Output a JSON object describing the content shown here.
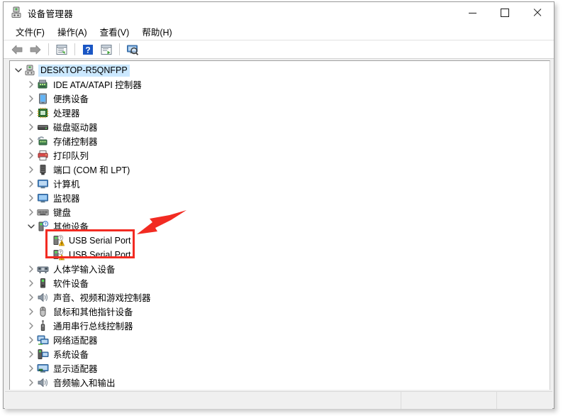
{
  "window": {
    "title": "设备管理器",
    "title_icon": "device-manager-icon",
    "controls": {
      "minimize": "最小化",
      "maximize": "最大化",
      "close": "关闭"
    }
  },
  "menubar": {
    "items": [
      {
        "label": "文件(F)",
        "name": "menu-file"
      },
      {
        "label": "操作(A)",
        "name": "menu-action"
      },
      {
        "label": "查看(V)",
        "name": "menu-view"
      },
      {
        "label": "帮助(H)",
        "name": "menu-help"
      }
    ]
  },
  "toolbar": {
    "items": [
      {
        "name": "back-icon",
        "title": "后退"
      },
      {
        "name": "forward-icon",
        "title": "前进"
      },
      {
        "name": "properties-icon",
        "title": "属性"
      },
      {
        "name": "help-icon",
        "title": "帮助"
      },
      {
        "name": "update-driver-icon",
        "title": "更新驱动程序"
      },
      {
        "name": "scan-hardware-icon",
        "title": "扫描检测硬件改动"
      }
    ]
  },
  "tree": {
    "root": {
      "label": "DESKTOP-R5QNFPP",
      "icon": "computer-icon",
      "expanded": true,
      "selected": true
    },
    "nodes": [
      {
        "label": "IDE ATA/ATAPI 控制器",
        "icon": "ide-controller-icon",
        "expanded": false,
        "warning": false
      },
      {
        "label": "便携设备",
        "icon": "portable-device-icon",
        "expanded": false,
        "warning": false
      },
      {
        "label": "处理器",
        "icon": "processor-icon",
        "expanded": false,
        "warning": false
      },
      {
        "label": "磁盘驱动器",
        "icon": "disk-drive-icon",
        "expanded": false,
        "warning": false
      },
      {
        "label": "存储控制器",
        "icon": "storage-controller-icon",
        "expanded": false,
        "warning": false
      },
      {
        "label": "打印队列",
        "icon": "print-queue-icon",
        "expanded": false,
        "warning": false
      },
      {
        "label": "端口 (COM 和 LPT)",
        "icon": "ports-icon",
        "expanded": false,
        "warning": false
      },
      {
        "label": "计算机",
        "icon": "computer-node-icon",
        "expanded": false,
        "warning": false
      },
      {
        "label": "监视器",
        "icon": "monitor-icon",
        "expanded": false,
        "warning": false
      },
      {
        "label": "键盘",
        "icon": "keyboard-icon",
        "expanded": false,
        "warning": false
      },
      {
        "label": "其他设备",
        "icon": "unknown-device-icon",
        "expanded": true,
        "warning": false
      },
      {
        "label": "USB Serial Port",
        "icon": "warning-device-icon",
        "child": true,
        "warning": true
      },
      {
        "label": "USB Serial Port",
        "icon": "warning-device-icon",
        "child": true,
        "warning": true
      },
      {
        "label": "人体学输入设备",
        "icon": "hid-icon",
        "expanded": false,
        "warning": false
      },
      {
        "label": "软件设备",
        "icon": "software-device-icon",
        "expanded": false,
        "warning": false
      },
      {
        "label": "声音、视频和游戏控制器",
        "icon": "sound-icon",
        "expanded": false,
        "warning": false
      },
      {
        "label": "鼠标和其他指针设备",
        "icon": "mouse-icon",
        "expanded": false,
        "warning": false
      },
      {
        "label": "通用串行总线控制器",
        "icon": "usb-controller-icon",
        "expanded": false,
        "warning": false
      },
      {
        "label": "网络适配器",
        "icon": "network-adapter-icon",
        "expanded": false,
        "warning": false
      },
      {
        "label": "系统设备",
        "icon": "system-device-icon",
        "expanded": false,
        "warning": false
      },
      {
        "label": "显示适配器",
        "icon": "display-adapter-icon",
        "expanded": false,
        "warning": false
      },
      {
        "label": "音频输入和输出",
        "icon": "audio-io-icon",
        "expanded": false,
        "warning": false
      }
    ]
  },
  "statusbar": {
    "pane1": "",
    "pane2": "",
    "pane3": ""
  },
  "annotations": {
    "highlight_color": "#f22b22",
    "box": {
      "label": "usb-serial-port-highlight"
    },
    "arrow": {
      "label": "usb-serial-port-pointer"
    }
  }
}
